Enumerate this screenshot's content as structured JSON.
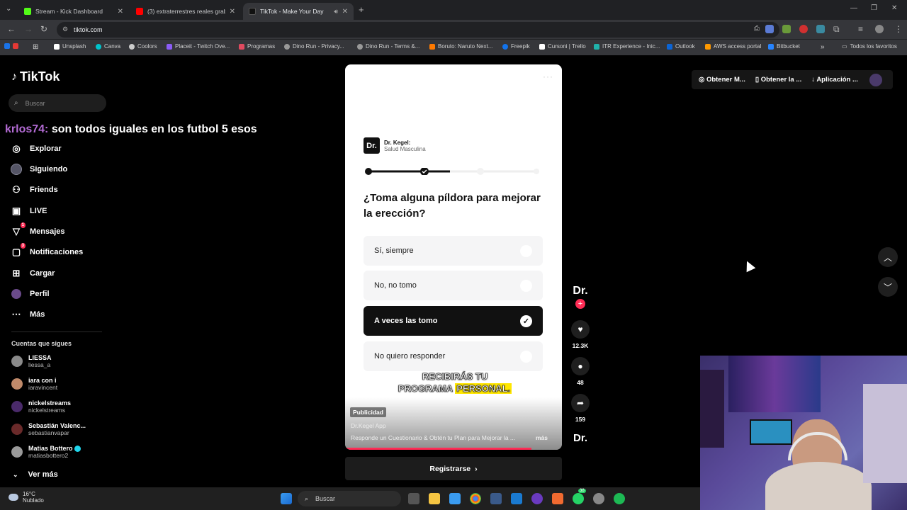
{
  "browser": {
    "tabs": [
      {
        "label": "Stream - Kick Dashboard",
        "color": "#53fc18"
      },
      {
        "label": "(3) extraterrestres reales grabad...",
        "color": "#ff0000"
      },
      {
        "label": "TikTok - Make Your Day",
        "color": "#111111"
      }
    ],
    "new_tab": "+",
    "url": "tiktok.com",
    "bookmarks": [
      {
        "label": "Unsplash",
        "color": "#ffffff"
      },
      {
        "label": "Canva",
        "color": "#00c4cc"
      },
      {
        "label": "Coolors",
        "color": "#cccccc"
      },
      {
        "label": "Placeit - Twitch Ove...",
        "color": "#8b5cf6"
      },
      {
        "label": "Programas",
        "color": "#e04a5f"
      },
      {
        "label": "Dino Run - Privacy...",
        "color": "#999999"
      },
      {
        "label": "Dino Run - Terms &...",
        "color": "#999999"
      },
      {
        "label": "Boruto: Naruto Next...",
        "color": "#ff7a00"
      },
      {
        "label": "Freepik",
        "color": "#1273eb"
      },
      {
        "label": "Cursoni | Trello",
        "color": "#ffffff"
      },
      {
        "label": "ITR Experience - Inic...",
        "color": "#20b2aa"
      },
      {
        "label": "Outlook",
        "color": "#0a64d6"
      },
      {
        "label": "AWS access portal",
        "color": "#ff9900"
      },
      {
        "label": "Bitbucket",
        "color": "#2684ff"
      }
    ],
    "bookmarks_more": "»",
    "all_favorites": "Todos los favoritos"
  },
  "tiktok": {
    "logo": "TikTok",
    "search_placeholder": "Buscar",
    "chat_overlay": {
      "user": "krlos74:",
      "message": " son todos iguales en los futbol 5 esos"
    },
    "nav": [
      {
        "label": "Explorar",
        "icon": "compass-icon",
        "badge": ""
      },
      {
        "label": "Siguiendo",
        "icon": "following-avatar-icon",
        "badge": ""
      },
      {
        "label": "Friends",
        "icon": "friends-icon",
        "badge": ""
      },
      {
        "label": "LIVE",
        "icon": "live-icon",
        "badge": ""
      },
      {
        "label": "Mensajes",
        "icon": "messages-icon",
        "badge": "1"
      },
      {
        "label": "Notificaciones",
        "icon": "notifications-icon",
        "badge": "3"
      },
      {
        "label": "Cargar",
        "icon": "upload-icon",
        "badge": ""
      },
      {
        "label": "Perfil",
        "icon": "profile-icon",
        "badge": ""
      },
      {
        "label": "Más",
        "icon": "more-icon",
        "badge": ""
      }
    ],
    "following_title": "Cuentas que sigues",
    "accounts": [
      {
        "name": "LIESSA",
        "handle": "liessa_a",
        "color": "#8a8a8a",
        "verified": false
      },
      {
        "name": "iara con i",
        "handle": "iaravincent",
        "color": "#c08a6a",
        "verified": false
      },
      {
        "name": "nickelstreams",
        "handle": "nickelstreams",
        "color": "#4a2a6a",
        "verified": false
      },
      {
        "name": "Sebastián Valenc...",
        "handle": "sebastianvapar",
        "color": "#6a2a2a",
        "verified": false
      },
      {
        "name": "Matias Bottero",
        "handle": "matiasbottero2",
        "color": "#9a9a9a",
        "verified": true
      }
    ],
    "see_more": "Ver más",
    "top_right": {
      "item1": "Obtener M...",
      "item2": "Obtener la ...",
      "item3": "Aplicación ..."
    }
  },
  "video": {
    "brand_logo": "Dr.",
    "brand_name": "Dr. Kegel:",
    "brand_sub": "Salud Masculina",
    "progress_steps_done": 2,
    "progress_steps_total": 4,
    "question": "¿Toma alguna píldora para mejorar la erección?",
    "options": [
      {
        "label": "Sí, siempre",
        "selected": false
      },
      {
        "label": "No, no tomo",
        "selected": false
      },
      {
        "label": "A veces las tomo",
        "selected": true
      },
      {
        "label": "No quiero responder",
        "selected": false
      }
    ],
    "caption_line1": "RECIBIRÁS TU",
    "caption_line2a": "PROGRAMA ",
    "caption_line2b": "PERSONAL.",
    "ad_badge": "Publicidad",
    "ad_account": "Dr.Kegel App",
    "ad_description": "Responde un Cuestionario & Obtén tu Plan para Mejorar la ...",
    "ad_more": "más",
    "register": "Registrarse",
    "playback_progress": 0.86
  },
  "actions": {
    "avatar": "Dr.",
    "follow": "+",
    "likes": "12.3K",
    "comments": "48",
    "shares": "159",
    "sound": "Dr."
  },
  "taskbar": {
    "temperature": "16°C",
    "weather": "Nublado",
    "search": "Buscar",
    "whatsapp_badge": "38"
  }
}
